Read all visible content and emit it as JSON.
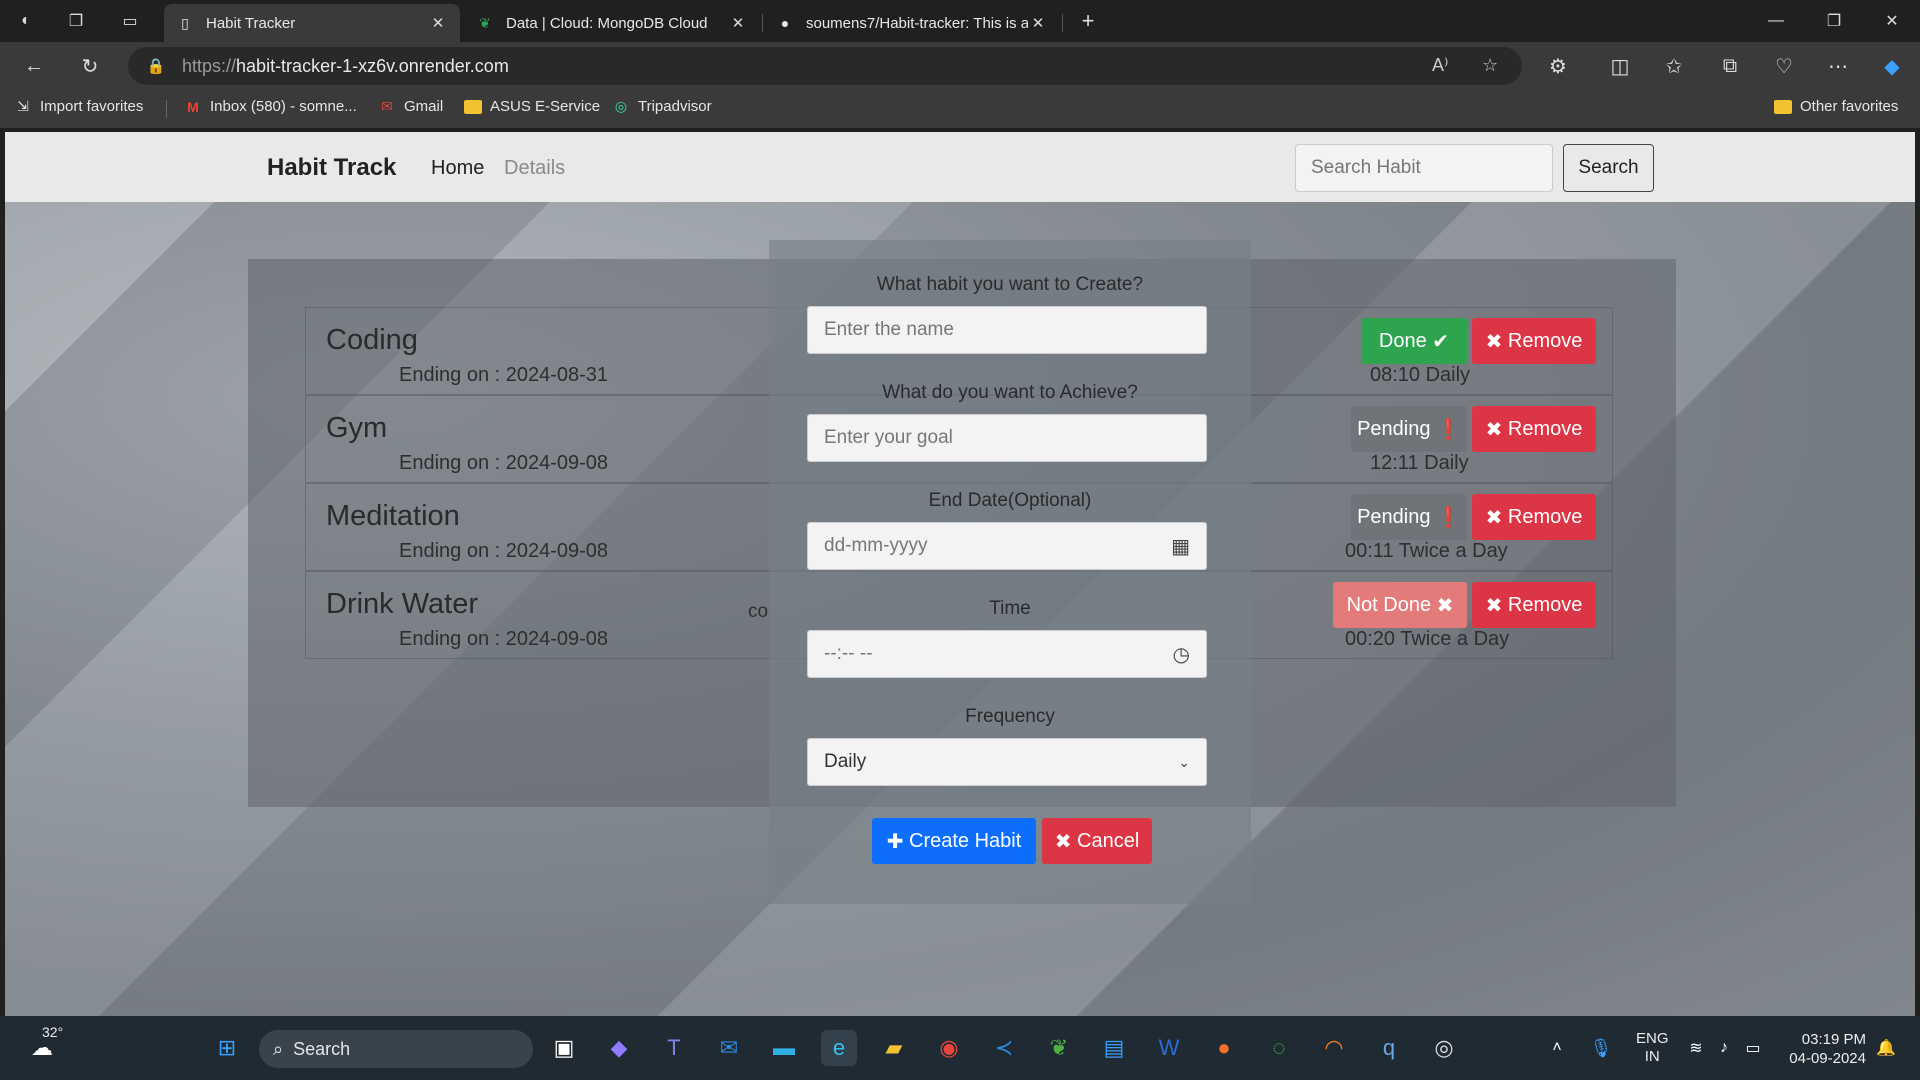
{
  "browser": {
    "tabs": [
      {
        "label": "Habit Tracker",
        "active": true
      },
      {
        "label": "Data | Cloud: MongoDB Cloud",
        "active": false
      },
      {
        "label": "soumens7/Habit-tracker: This is a",
        "active": false
      }
    ],
    "url_scheme": "https://",
    "url_host": "habit-tracker-1-xz6v.onrender.com",
    "bookmarks": [
      "Import favorites",
      "Inbox (580) - somne...",
      "Gmail",
      "ASUS E-Service",
      "Tripadvisor"
    ],
    "other_favorites": "Other favorites"
  },
  "navbar": {
    "brand": "Habit Track",
    "links": [
      "Home",
      "Details"
    ],
    "search_placeholder": "Search Habit",
    "search_button": "Search"
  },
  "habits": [
    {
      "name": "Coding",
      "ending": "Ending on : 2024-08-31",
      "status": "Done",
      "status_icon": "check-icon",
      "time": "08:10 Daily",
      "remove": "Remove"
    },
    {
      "name": "Gym",
      "ending": "Ending on : 2024-09-08",
      "status": "Pending",
      "status_icon": "exclamation-icon",
      "time": "12:11 Daily",
      "remove": "Remove"
    },
    {
      "name": "Meditation",
      "ending": "Ending on : 2024-09-08",
      "status": "Pending",
      "status_icon": "exclamation-icon",
      "time": "00:11 Twice a Day",
      "remove": "Remove"
    },
    {
      "name": "Drink Water",
      "ending": "Ending on : 2024-09-08",
      "status": "Not Done",
      "status_icon": "x-icon",
      "time": "00:20 Twice a Day",
      "remove": "Remove"
    }
  ],
  "partial_text": "co",
  "form": {
    "q_name": "What habit you want to Create?",
    "name_placeholder": "Enter the name",
    "q_goal": "What do you want to Achieve?",
    "goal_placeholder": "Enter your goal",
    "q_date": "End Date(Optional)",
    "date_placeholder": "dd-mm-yyyy",
    "q_time": "Time",
    "time_placeholder": "--:-- --",
    "q_frequency": "Frequency",
    "frequency_selected": "Daily",
    "create_button": "Create Habit",
    "cancel_button": "Cancel"
  },
  "taskbar": {
    "weather_temp": "32°",
    "search_label": "Search",
    "lang_top": "ENG",
    "lang_bottom": "IN",
    "time": "03:19 PM",
    "date": "04-09-2024"
  },
  "colors": {
    "done": "#2ea44f",
    "pending": "#6f7479",
    "not_done": "#e47b7b",
    "remove": "#dc3545",
    "create": "#0d6efd"
  }
}
